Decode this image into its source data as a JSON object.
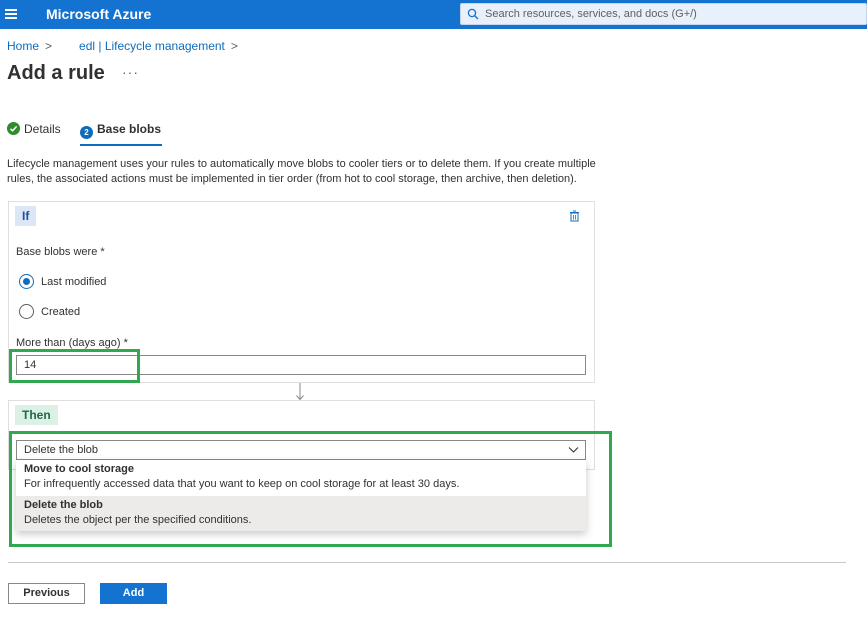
{
  "topbar": {
    "brand": "Microsoft Azure",
    "search_placeholder": "Search resources, services, and docs (G+/)"
  },
  "breadcrumb": {
    "home": "Home",
    "separator": ">",
    "current": "edl | Lifecycle management"
  },
  "page": {
    "title": "Add a rule",
    "more": "···"
  },
  "tabs": {
    "details": "Details",
    "base_blobs_step": "2",
    "base_blobs": "Base blobs"
  },
  "description": "Lifecycle management uses your rules to automatically move blobs to cooler tiers or to delete them. If you create multiple rules, the associated actions must be implemented in tier order (from hot to cool storage, then archive, then deletion).",
  "if_block": {
    "chip": "If",
    "base_blobs_label": "Base blobs were *",
    "radio_last_modified": "Last modified",
    "radio_created": "Created",
    "days_label": "More than (days ago) *",
    "days_value": "14"
  },
  "then_block": {
    "chip": "Then",
    "selected": "Delete the blob",
    "options": [
      {
        "title": "Move to cool storage",
        "desc": "For infrequently accessed data that you want to keep on cool storage for at least 30 days."
      },
      {
        "title": "Delete the blob",
        "desc": "Deletes the object per the specified conditions."
      }
    ]
  },
  "footer": {
    "previous": "Previous",
    "add": "Add"
  },
  "colors": {
    "azure_blue": "#1473d1",
    "highlight_green": "#31a84f"
  }
}
